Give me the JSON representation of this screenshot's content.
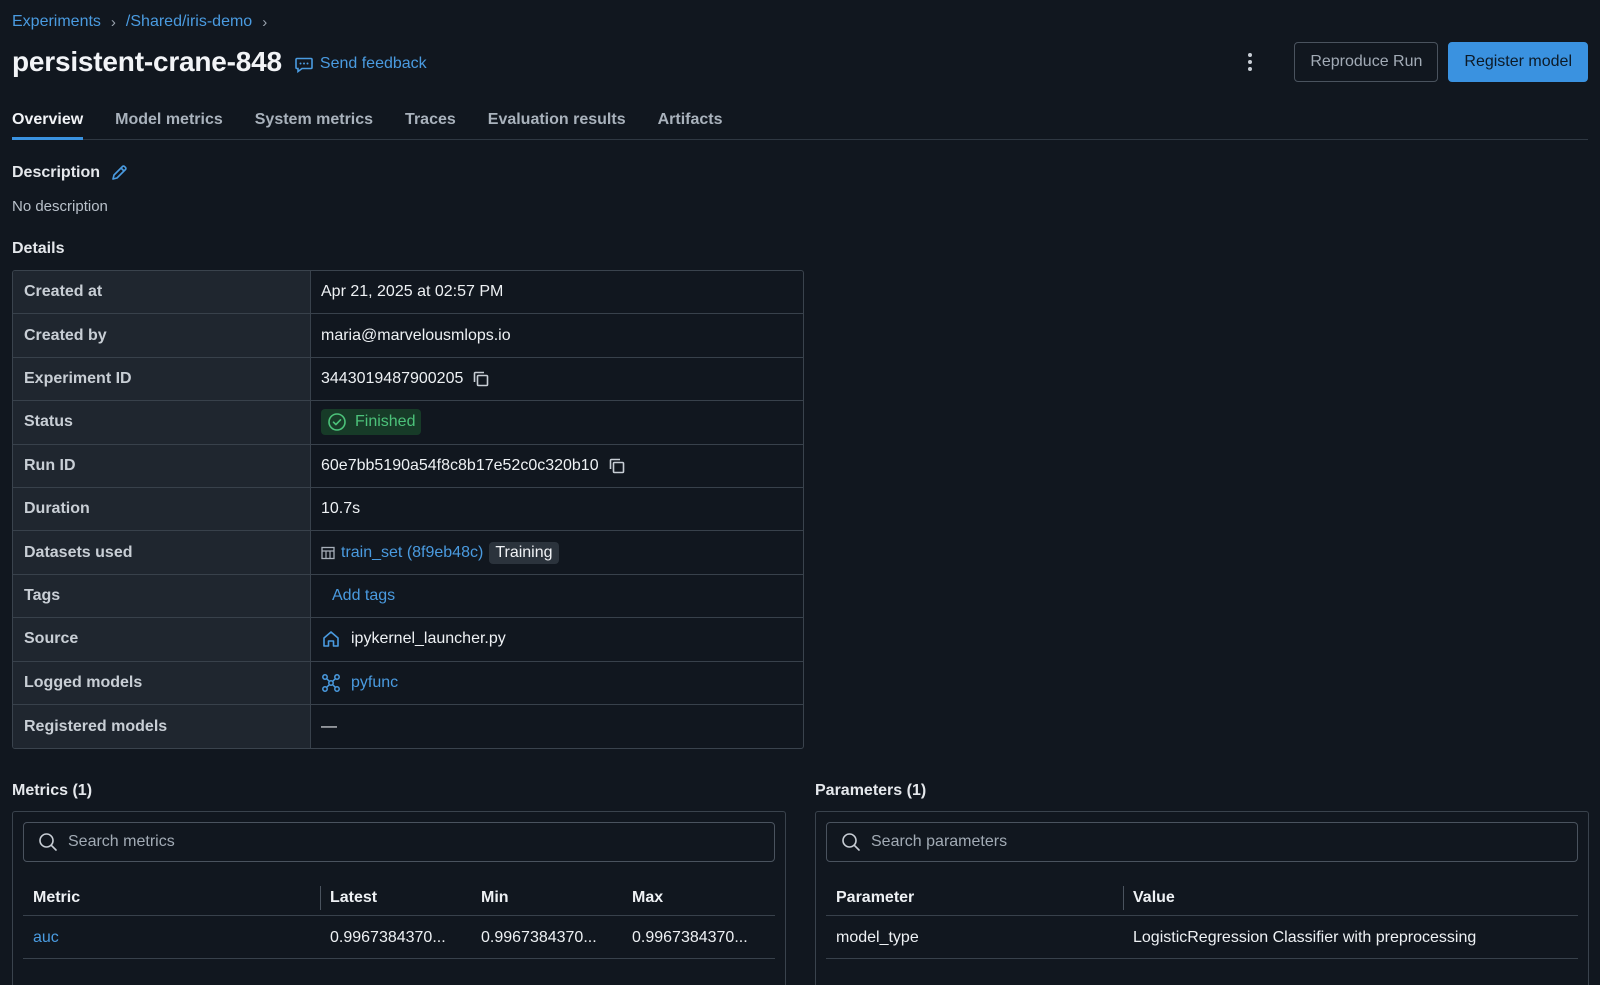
{
  "breadcrumb": {
    "items": [
      "Experiments",
      "/Shared/iris-demo"
    ]
  },
  "header": {
    "title": "persistent-crane-848",
    "feedback_label": "Send feedback",
    "reproduce_label": "Reproduce Run",
    "register_label": "Register model"
  },
  "tabs": [
    "Overview",
    "Model metrics",
    "System metrics",
    "Traces",
    "Evaluation results",
    "Artifacts"
  ],
  "description": {
    "heading": "Description",
    "text": "No description"
  },
  "details": {
    "heading": "Details",
    "created_at": {
      "label": "Created at",
      "value": "Apr 21, 2025 at 02:57 PM"
    },
    "created_by": {
      "label": "Created by",
      "value": "maria@marvelousmlops.io"
    },
    "experiment_id": {
      "label": "Experiment ID",
      "value": "3443019487900205"
    },
    "status": {
      "label": "Status",
      "value": "Finished"
    },
    "run_id": {
      "label": "Run ID",
      "value": "60e7bb5190a54f8c8b17e52c0c320b10"
    },
    "duration": {
      "label": "Duration",
      "value": "10.7s"
    },
    "datasets": {
      "label": "Datasets used",
      "dataset": "train_set (8f9eb48c)",
      "context": "Training"
    },
    "tags": {
      "label": "Tags",
      "add_label": "Add tags"
    },
    "source": {
      "label": "Source",
      "value": "ipykernel_launcher.py"
    },
    "logged_models": {
      "label": "Logged models",
      "value": "pyfunc"
    },
    "registered_models": {
      "label": "Registered models",
      "value": "—"
    }
  },
  "metrics": {
    "heading": "Metrics (1)",
    "search_placeholder": "Search metrics",
    "columns": [
      "Metric",
      "Latest",
      "Min",
      "Max"
    ],
    "rows": [
      {
        "name": "auc",
        "latest": "0.9967384370...",
        "min": "0.9967384370...",
        "max": "0.9967384370..."
      }
    ]
  },
  "parameters": {
    "heading": "Parameters (1)",
    "search_placeholder": "Search parameters",
    "columns": [
      "Parameter",
      "Value"
    ],
    "rows": [
      {
        "name": "model_type",
        "value": "LogisticRegression Classifier with preprocessing"
      }
    ]
  },
  "colors": {
    "accent": "#3a92e0",
    "link": "#4a9be0",
    "success": "#4cc27a",
    "background": "#11171f"
  }
}
